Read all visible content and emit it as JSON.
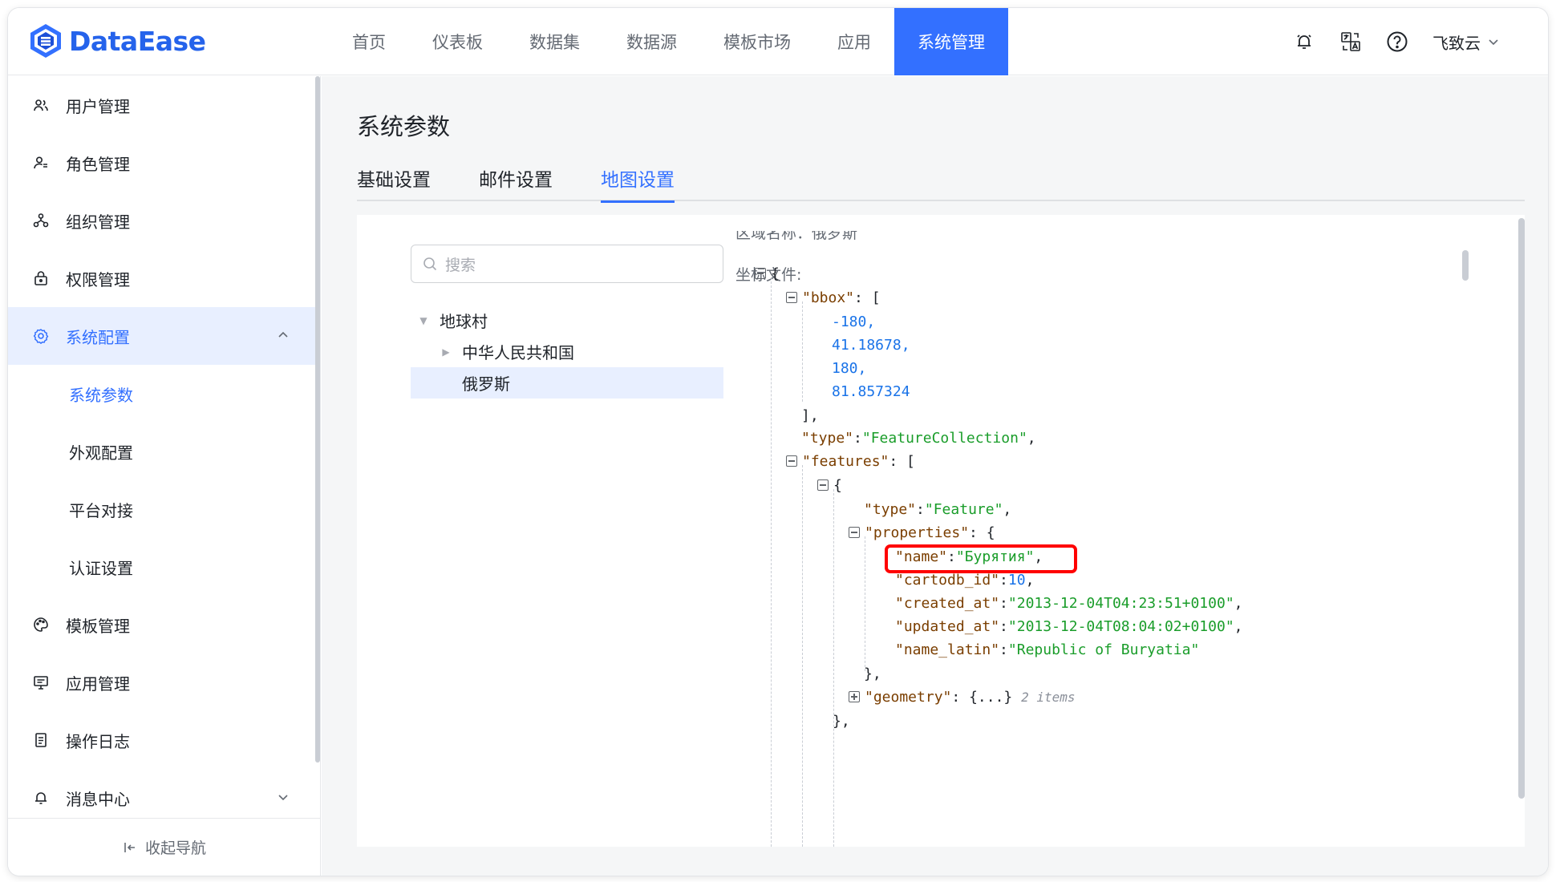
{
  "app": {
    "logo_text": "DataEase"
  },
  "nav": {
    "items": [
      {
        "label": "首页"
      },
      {
        "label": "仪表板"
      },
      {
        "label": "数据集"
      },
      {
        "label": "数据源"
      },
      {
        "label": "模板市场"
      },
      {
        "label": "应用"
      },
      {
        "label": "系统管理"
      }
    ],
    "active_index": 6
  },
  "header": {
    "user_name": "飞致云"
  },
  "sidebar": {
    "items": [
      {
        "label": "用户管理",
        "icon": "users-icon"
      },
      {
        "label": "角色管理",
        "icon": "role-icon"
      },
      {
        "label": "组织管理",
        "icon": "org-icon"
      },
      {
        "label": "权限管理",
        "icon": "lock-icon"
      },
      {
        "label": "系统配置",
        "icon": "gear-icon"
      },
      {
        "label": "模板管理",
        "icon": "palette-icon"
      },
      {
        "label": "应用管理",
        "icon": "monitor-icon"
      },
      {
        "label": "操作日志",
        "icon": "doc-icon"
      },
      {
        "label": "消息中心",
        "icon": "bell-icon"
      }
    ],
    "sub_items": [
      {
        "label": "系统参数"
      },
      {
        "label": "外观配置"
      },
      {
        "label": "平台对接"
      },
      {
        "label": "认证设置"
      }
    ],
    "collapse_label": "收起导航"
  },
  "page": {
    "title": "系统参数",
    "tabs": [
      {
        "label": "基础设置"
      },
      {
        "label": "邮件设置"
      },
      {
        "label": "地图设置"
      }
    ],
    "active_tab": 2
  },
  "map": {
    "search_placeholder": "搜索",
    "tree": [
      {
        "label": "地球村",
        "expanded": true,
        "level": 0
      },
      {
        "label": "中华人民共和国",
        "expanded": false,
        "level": 1
      },
      {
        "label": "俄罗斯",
        "selected": true,
        "level": 1
      }
    ],
    "truncated_label": "区域名称：俄罗斯",
    "coord_label": "坐标文件:",
    "geojson": {
      "bbox": [
        "-180",
        "41.18678",
        "180",
        "81.857324"
      ],
      "type": "FeatureCollection",
      "feature_type": "Feature",
      "properties": {
        "name": "Бурятия",
        "cartodb_id": "10",
        "created_at": "2013-12-04T04:23:51+0100",
        "updated_at": "2013-12-04T08:04:02+0100",
        "name_latin": "Republic of Buryatia"
      },
      "geometry_collapsed": "{...}",
      "geometry_count": "2 items"
    }
  },
  "colors": {
    "accent": "#3370ff",
    "highlight_box": "#ff0000"
  }
}
